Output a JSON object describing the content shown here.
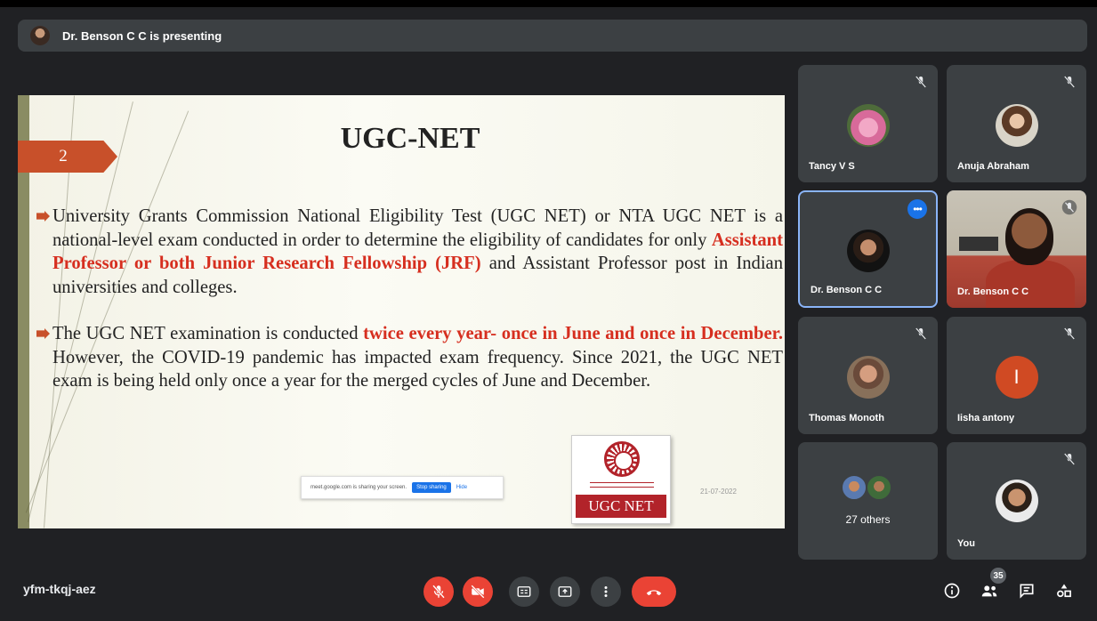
{
  "presenter_bar": {
    "text": "Dr. Benson C C is presenting"
  },
  "slide": {
    "number": "2",
    "title": "UGC-NET",
    "p1": [
      "University Grants Commission National Eligibility Test (UGC NET) or NTA UGC NET is a national-level exam conducted in order to determine the eligibility of candidates for only ",
      "Assistant Professor or both Junior Research Fellowship (JRF)",
      " and Assistant Professor post in Indian universities and colleges."
    ],
    "p2": [
      "The UGC NET examination is conducted ",
      "twice every year- once in June and once in December.",
      " However, the COVID-19 pandemic has impacted exam frequency. Since 2021, the UGC NET exam is being held only once a year for the merged cycles of June and December."
    ],
    "share_notice": "meet.google.com is sharing your screen.",
    "share_stop": "Stop sharing",
    "share_hide": "Hide",
    "logo_text": "UGC NET",
    "date": "21-07-2022"
  },
  "participants": [
    {
      "name": "Tancy V S",
      "muted": true
    },
    {
      "name": "Anuja Abraham",
      "muted": true
    },
    {
      "name": "Dr. Benson C C",
      "muted": false,
      "active": true
    },
    {
      "name": "Dr. Benson C C",
      "muted": true,
      "video": true
    },
    {
      "name": "Thomas Monoth",
      "muted": true
    },
    {
      "name": "Iisha antony",
      "muted": true,
      "initial": "I",
      "color": "#d04a23"
    },
    {
      "name": "27 others",
      "muted": false
    },
    {
      "name": "You",
      "muted": true
    }
  ],
  "bottom_bar": {
    "meeting_code": "yfm-tkqj-aez",
    "participant_count": "35"
  },
  "colors": {
    "accent": "#1a73e8",
    "danger": "#ea4335",
    "slide_accent": "#c8502a",
    "slide_highlight": "#d62e1f"
  }
}
